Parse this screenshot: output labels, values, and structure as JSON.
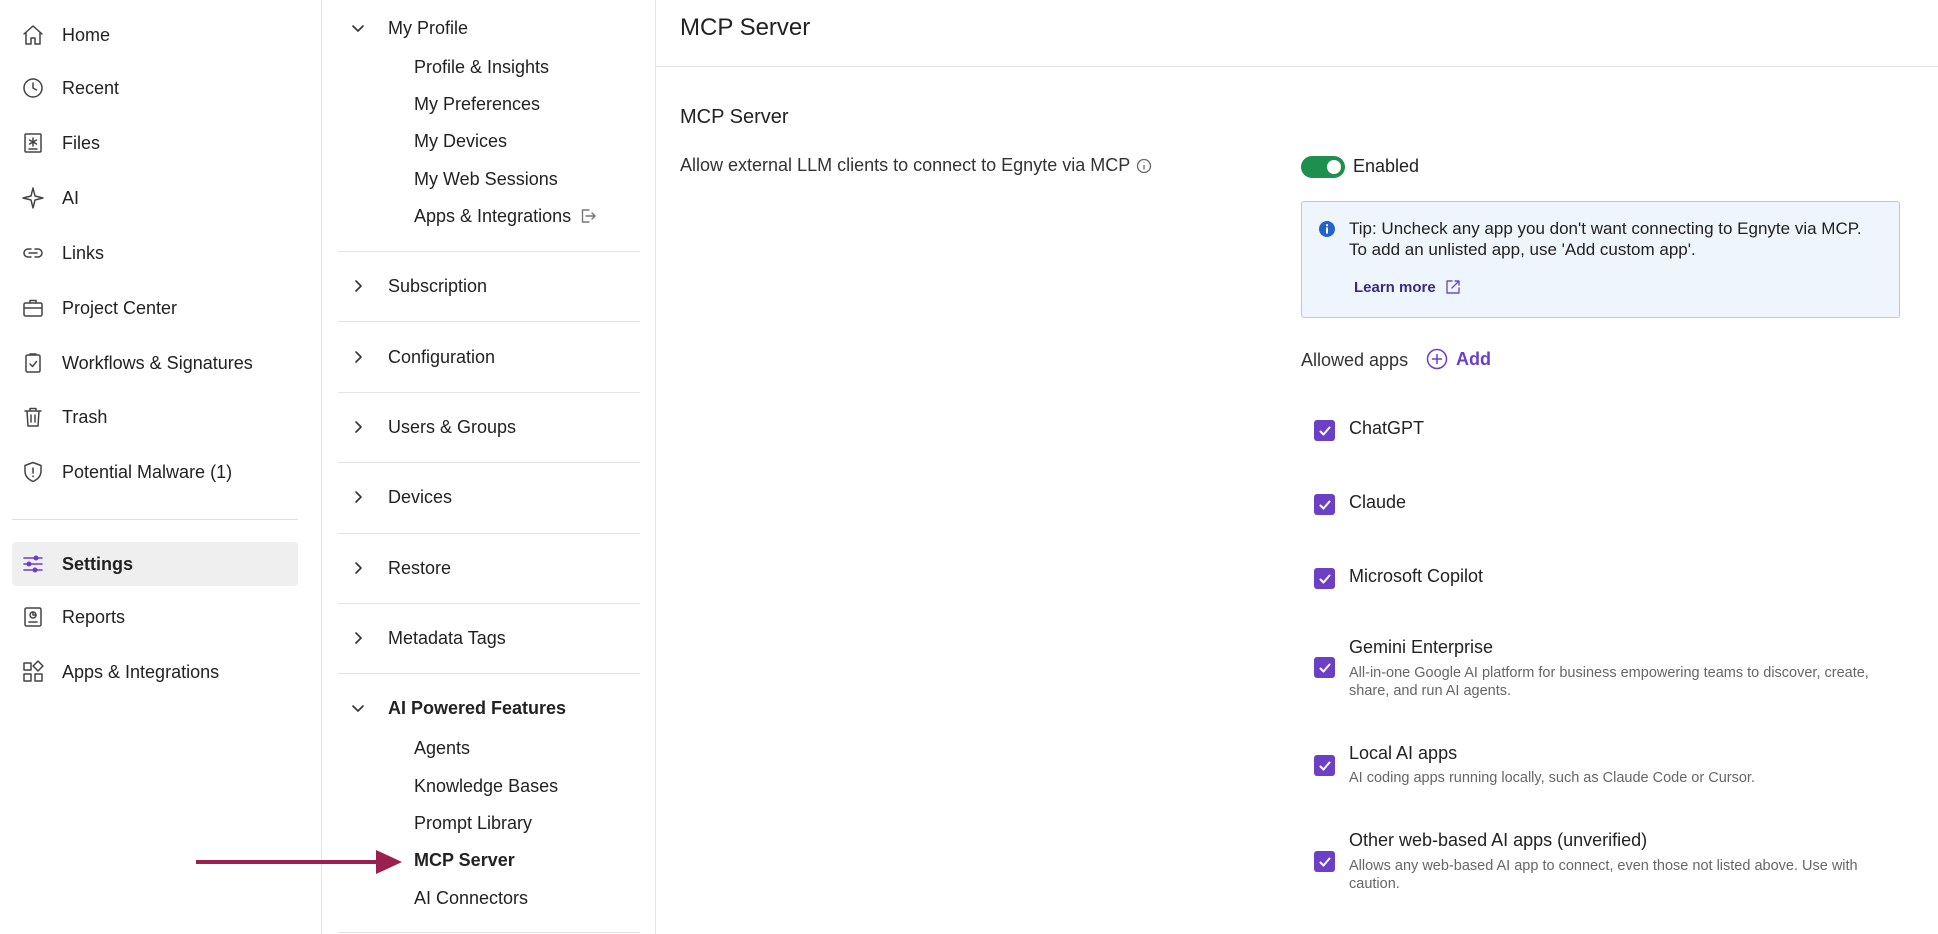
{
  "leftnav": {
    "items": [
      {
        "label": "Home",
        "icon": "home-icon"
      },
      {
        "label": "Recent",
        "icon": "clock-icon"
      },
      {
        "label": "Files",
        "icon": "files-icon"
      },
      {
        "label": "AI",
        "icon": "sparkle-icon"
      },
      {
        "label": "Links",
        "icon": "link-icon"
      },
      {
        "label": "Project Center",
        "icon": "briefcase-icon"
      },
      {
        "label": "Workflows & Signatures",
        "icon": "clipboard-check-icon"
      },
      {
        "label": "Trash",
        "icon": "trash-icon"
      },
      {
        "label": "Potential Malware (1)",
        "icon": "shield-alert-icon"
      },
      {
        "label": "Settings",
        "icon": "sliders-icon",
        "active": true
      },
      {
        "label": "Reports",
        "icon": "reports-icon"
      },
      {
        "label": "Apps & Integrations",
        "icon": "apps-icon"
      }
    ]
  },
  "tree": {
    "my_profile": {
      "label": "My Profile",
      "items": [
        "Profile & Insights",
        "My Preferences",
        "My Devices",
        "My Web Sessions",
        "Apps & Integrations"
      ]
    },
    "groups": [
      "Subscription",
      "Configuration",
      "Users & Groups",
      "Devices",
      "Restore",
      "Metadata Tags"
    ],
    "ai_features": {
      "label": "AI Powered Features",
      "items": [
        "Agents",
        "Knowledge Bases",
        "Prompt Library",
        "MCP Server",
        "AI Connectors"
      ],
      "selected": "MCP Server"
    }
  },
  "main": {
    "page_title": "MCP Server",
    "section_title": "MCP Server",
    "setting_label": "Allow external LLM clients to connect to Egnyte via MCP",
    "toggle": {
      "state": "on",
      "label": "Enabled",
      "color": "#1f8f4e"
    },
    "tip": {
      "text": "Tip: Uncheck any app you don't want connecting to Egnyte via MCP. To add an unlisted app, use 'Add custom app'.",
      "link": "Learn more"
    },
    "allowed_label": "Allowed apps",
    "add_label": "Add",
    "apps": [
      {
        "name": "ChatGPT",
        "checked": true,
        "desc": ""
      },
      {
        "name": "Claude",
        "checked": true,
        "desc": ""
      },
      {
        "name": "Microsoft Copilot",
        "checked": true,
        "desc": ""
      },
      {
        "name": "Gemini Enterprise",
        "checked": true,
        "desc": "All-in-one Google AI platform for business empowering teams to discover, create, share, and run AI agents."
      },
      {
        "name": "Local AI apps",
        "checked": true,
        "desc": "AI coding apps running locally, such as Claude Code or Cursor."
      },
      {
        "name": "Other web-based AI apps (unverified)",
        "checked": true,
        "desc": "Allows any web-based AI app to connect, even those not listed above. Use with caution."
      }
    ]
  },
  "colors": {
    "accent": "#6b3fc6",
    "toggle_on": "#1f8f4e",
    "arrow": "#9b1f4f",
    "tip_bg": "#eef5fc"
  }
}
